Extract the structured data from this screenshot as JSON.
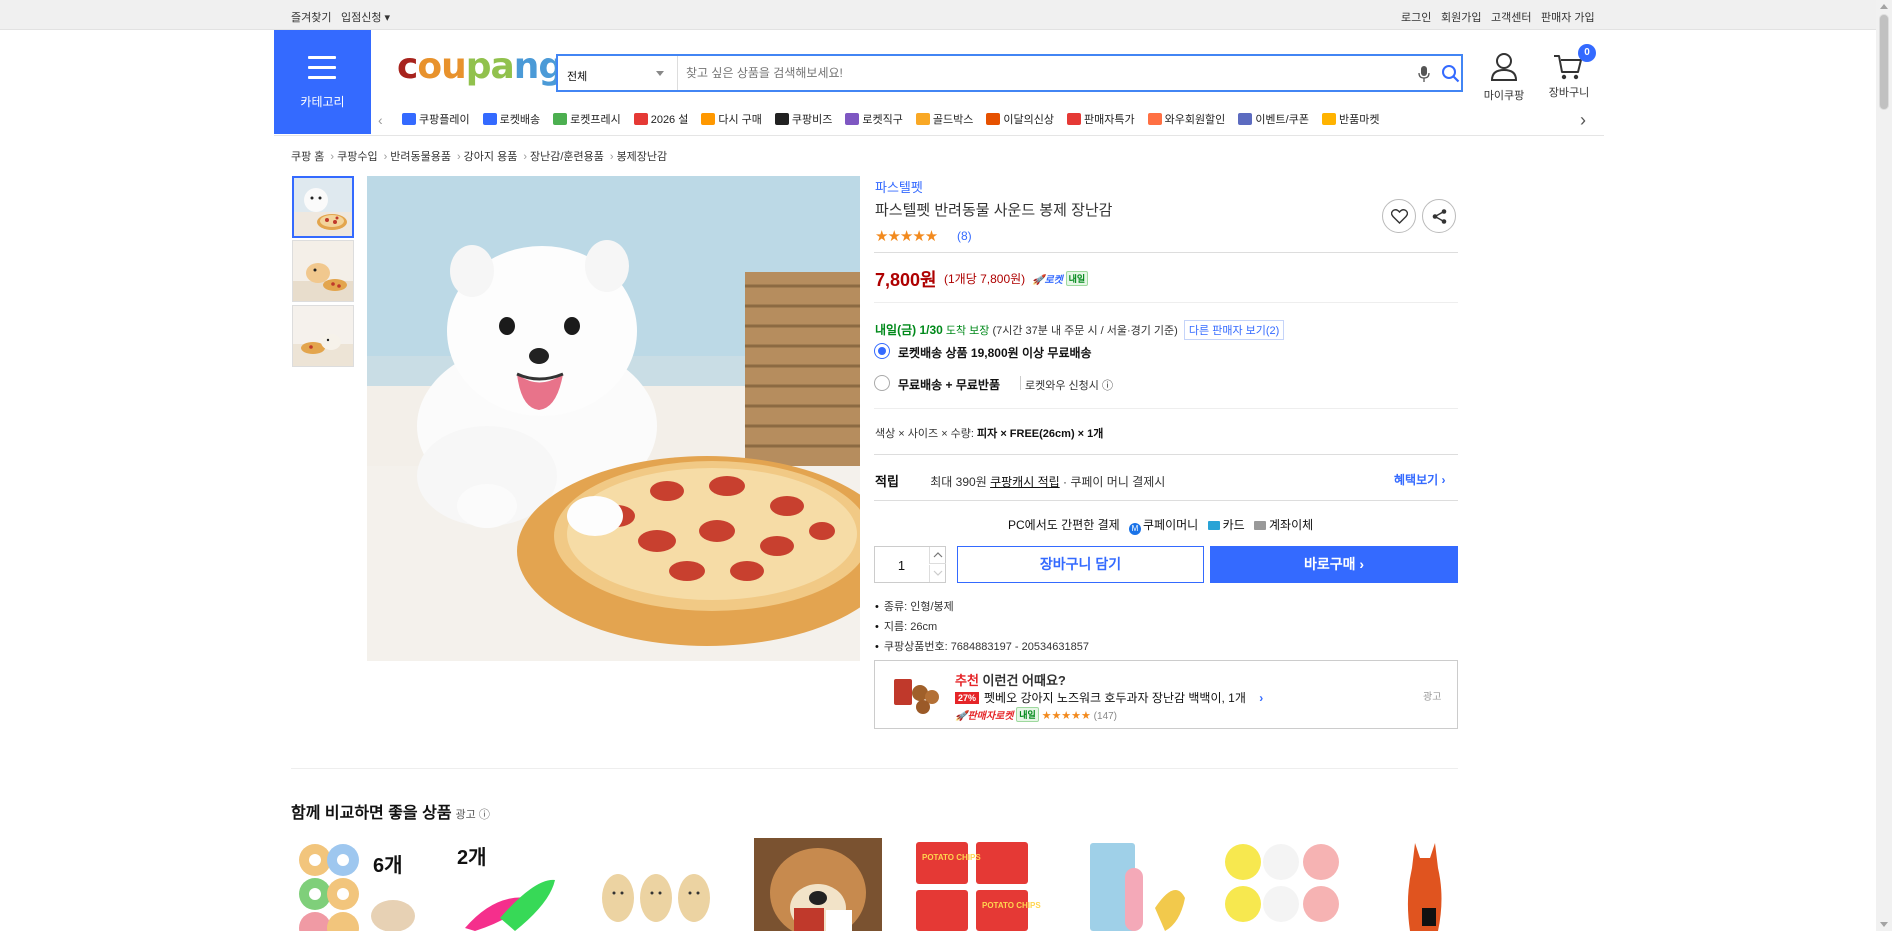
{
  "topbar": {
    "left": [
      "즐겨찾기",
      "입점신청 ▾"
    ],
    "right": [
      "로그인",
      "회원가입",
      "고객센터",
      "판매자 가입"
    ]
  },
  "header": {
    "category_label": "카테고리",
    "logo": {
      "c1": "c",
      "c2": "ou",
      "c3": "pa",
      "c4": "ng"
    },
    "search_category": "전체",
    "search_placeholder": "찾고 싶은 상품을 검색해보세요!",
    "mypage_label": "마이쿠팡",
    "cart_label": "장바구니",
    "cart_count": "0"
  },
  "catnav": [
    {
      "label": "쿠팡플레이",
      "color": "#346aff"
    },
    {
      "label": "로켓배송",
      "color": "#346aff"
    },
    {
      "label": "로켓프레시",
      "color": "#4caf50"
    },
    {
      "label": "2026 설",
      "color": "#e53935"
    },
    {
      "label": "다시 구매",
      "color": "#ff9800"
    },
    {
      "label": "쿠팡비즈",
      "color": "#222222"
    },
    {
      "label": "로켓직구",
      "color": "#7e57c2"
    },
    {
      "label": "골드박스",
      "color": "#f9a825"
    },
    {
      "label": "이달의신상",
      "color": "#e65100"
    },
    {
      "label": "판매자특가",
      "color": "#e53935"
    },
    {
      "label": "와우회원할인",
      "color": "#ff7043"
    },
    {
      "label": "이벤트/쿠폰",
      "color": "#5c6bc0"
    },
    {
      "label": "반품마켓",
      "color": "#ffb300"
    }
  ],
  "breadcrumb": [
    "쿠팡 홈",
    "쿠팡수입",
    "반려동물용품",
    "강아지 용품",
    "장난감/훈련용품",
    "봉제장난감"
  ],
  "product": {
    "brand": "파스텔펫",
    "title": "파스텔펫 반려동물 사운드 봉제 장난감",
    "stars": "★★★★★",
    "review_count": "(8)",
    "price": "7,800원",
    "unit_price": "(1개당 7,800원)",
    "rocket_badge": "로켓",
    "rocket_tomorrow": "내일",
    "delivery_date": "내일(금) 1/30",
    "delivery_guarantee": "도착 보장",
    "delivery_condition": "(7시간 37분 내 주문 시 / 서울·경기 기준)",
    "other_seller": "다른 판매자 보기(2)",
    "option1": "로켓배송 상품 19,800원 이상 무료배송",
    "option2": "무료배송 + 무료반품",
    "option2_note": "로켓와우 신청시 ⓘ",
    "option_summary_prefix": "색상 × 사이즈 × 수량:",
    "option_summary_value": "피자 × FREE(26cm) × 1개",
    "points_label": "적립",
    "points_text_pre": "최대 390원",
    "points_link": "쿠팡캐시 적립",
    "points_text_post": "· 쿠페이 머니 결제시",
    "benefit_link": "혜택보기 ›",
    "pay_prefix": "PC에서도 간편한 결제",
    "pay_money": "쿠페이머니",
    "pay_card": "카드",
    "pay_bank": "계좌이체",
    "quantity": "1",
    "cart_button": "장바구니 담기",
    "buy_button": "바로구매 ›",
    "specs": [
      "종류: 인형/봉제",
      "지름: 26cm",
      "쿠팡상품번호: 7684883197 - 20534631857"
    ]
  },
  "recommend": {
    "title_red": "추천",
    "title_rest": "이런건 어때요?",
    "discount": "27%",
    "name": "펫베오 강아지 노즈워크 호두과자 장난감 백백이, 1개",
    "badge": "판매자로켓",
    "tomorrow": "내일",
    "stars": "★★★★★",
    "reviews": "(147)",
    "ad": "광고"
  },
  "compare": {
    "title": "함께 비교하면 좋을 상품",
    "ad": "광고 ⓘ",
    "items": [
      "6개",
      "2개",
      "",
      "",
      "POTATO CHIPS",
      "",
      "",
      ""
    ]
  },
  "colors": {
    "accent": "#346aff",
    "price": "#ae0000",
    "delivery": "#00891a"
  }
}
